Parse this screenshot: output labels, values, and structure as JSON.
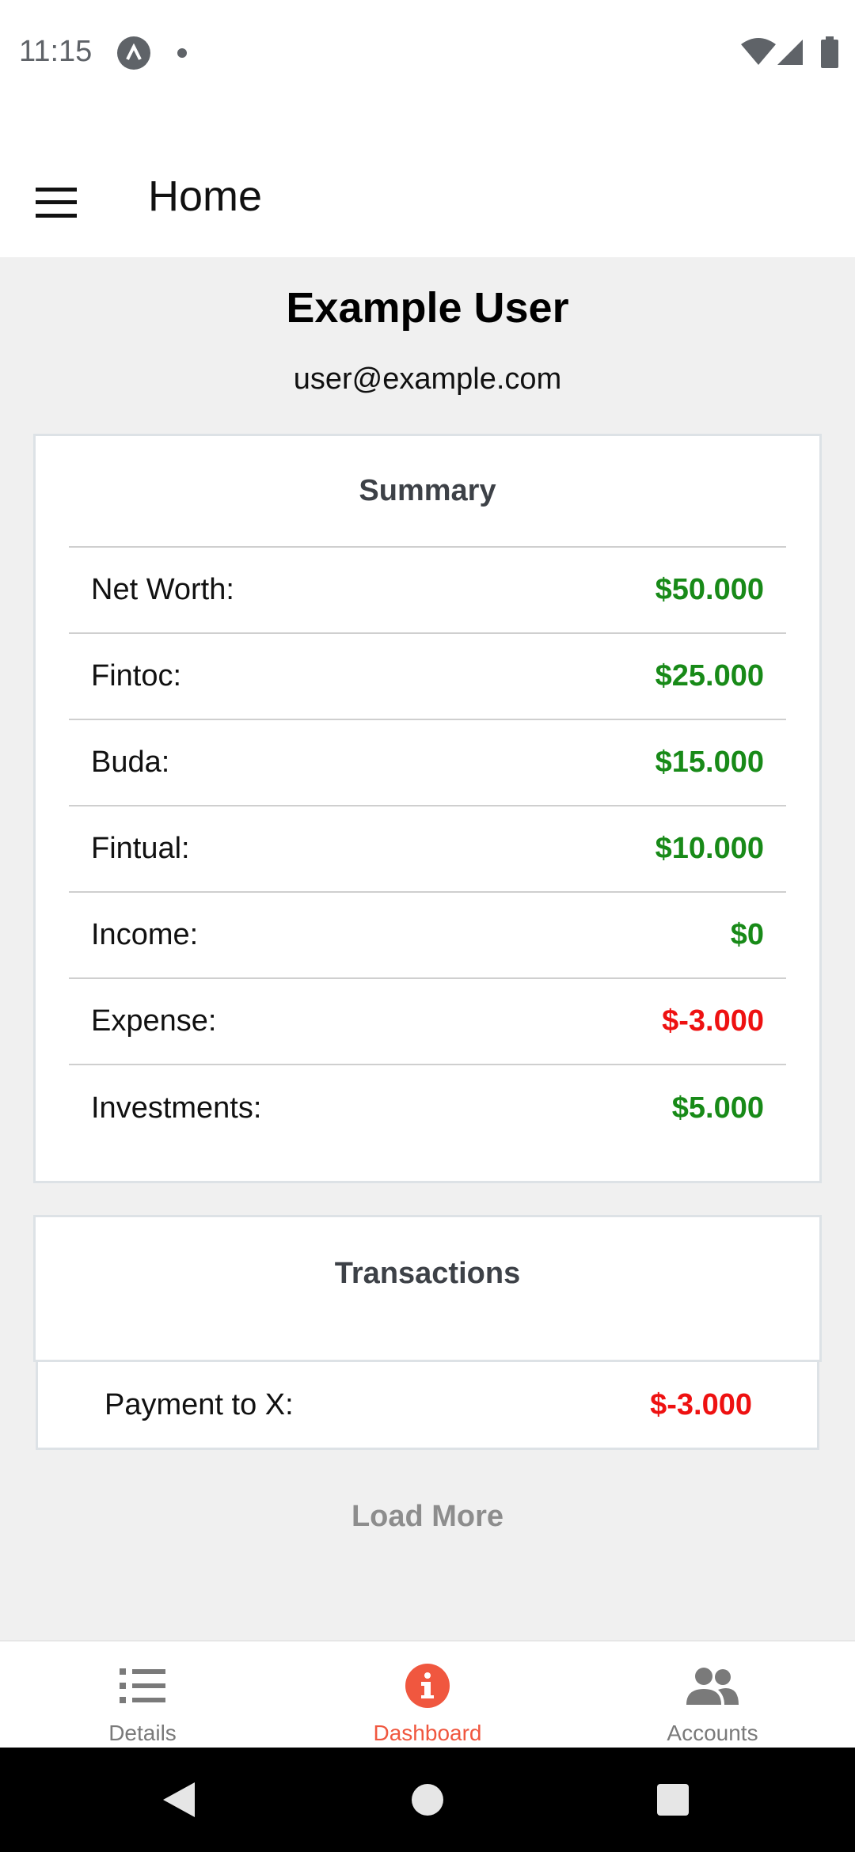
{
  "status_bar": {
    "time": "11:15"
  },
  "app_bar": {
    "title": "Home",
    "menu_icon": "hamburger-menu-icon"
  },
  "profile": {
    "name": "Example User",
    "email": "user@example.com"
  },
  "summary": {
    "title": "Summary",
    "rows": [
      {
        "label": "Net Worth:",
        "value": "$50.000",
        "status": "positive"
      },
      {
        "label": "Fintoc:",
        "value": "$25.000",
        "status": "positive"
      },
      {
        "label": "Buda:",
        "value": "$15.000",
        "status": "positive"
      },
      {
        "label": "Fintual:",
        "value": "$10.000",
        "status": "positive"
      },
      {
        "label": "Income:",
        "value": "$0",
        "status": "positive"
      },
      {
        "label": "Expense:",
        "value": "$-3.000",
        "status": "negative"
      },
      {
        "label": "Investments:",
        "value": "$5.000",
        "status": "positive"
      }
    ]
  },
  "transactions": {
    "title": "Transactions",
    "items": [
      {
        "label": "Payment to X:",
        "value": "$-3.000",
        "status": "negative"
      }
    ],
    "load_more_label": "Load More"
  },
  "bottom_nav": {
    "items": [
      {
        "label": "Details",
        "icon": "list-icon",
        "active": false
      },
      {
        "label": "Dashboard",
        "icon": "info-icon",
        "active": true
      },
      {
        "label": "Accounts",
        "icon": "people-icon",
        "active": false
      }
    ]
  },
  "colors": {
    "positive": "#188a18",
    "negative": "#ee1111",
    "accent": "#f0573f",
    "inactive": "#7a7a7a"
  }
}
